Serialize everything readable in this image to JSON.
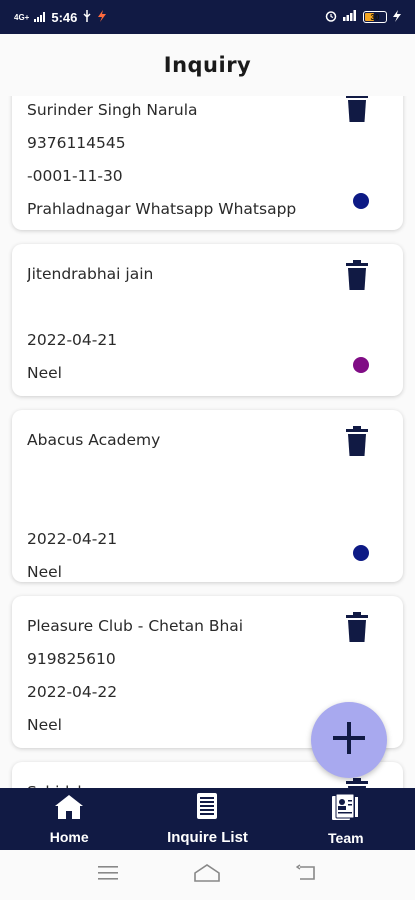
{
  "status_bar": {
    "network": "4G+",
    "time": "5:46",
    "battery": "30"
  },
  "header": {
    "title": "Inquiry"
  },
  "inquiries": [
    {
      "name": "Surinder Singh Narula",
      "phone": "9376114545",
      "date": "-0001-11-30",
      "source": "Prahladnagar Whatsapp Whatsapp",
      "status_color": "#0d1a85"
    },
    {
      "name": "Jitendrabhai jain",
      "phone": "",
      "date": "2022-04-21",
      "source": "Neel",
      "status_color": "#800c85"
    },
    {
      "name": "Abacus Academy",
      "phone": "",
      "date": "2022-04-21",
      "source": "Neel",
      "status_color": "#0d1a85"
    },
    {
      "name": "Pleasure Club - Chetan Bhai",
      "phone": "919825610",
      "date": "2022-04-22",
      "source": "Neel",
      "status_color": ""
    },
    {
      "name": "Schjdsk",
      "phone": "",
      "date": "",
      "source": "",
      "status_color": ""
    }
  ],
  "bottom_nav": {
    "items": [
      {
        "label": "Home",
        "icon": "home-icon"
      },
      {
        "label": "Inquire List",
        "icon": "list-document-icon"
      },
      {
        "label": "Team",
        "icon": "team-document-icon"
      }
    ]
  },
  "fab": {
    "icon": "plus-icon"
  },
  "colors": {
    "primary": "#111a44",
    "fab": "#a8a9ef"
  }
}
